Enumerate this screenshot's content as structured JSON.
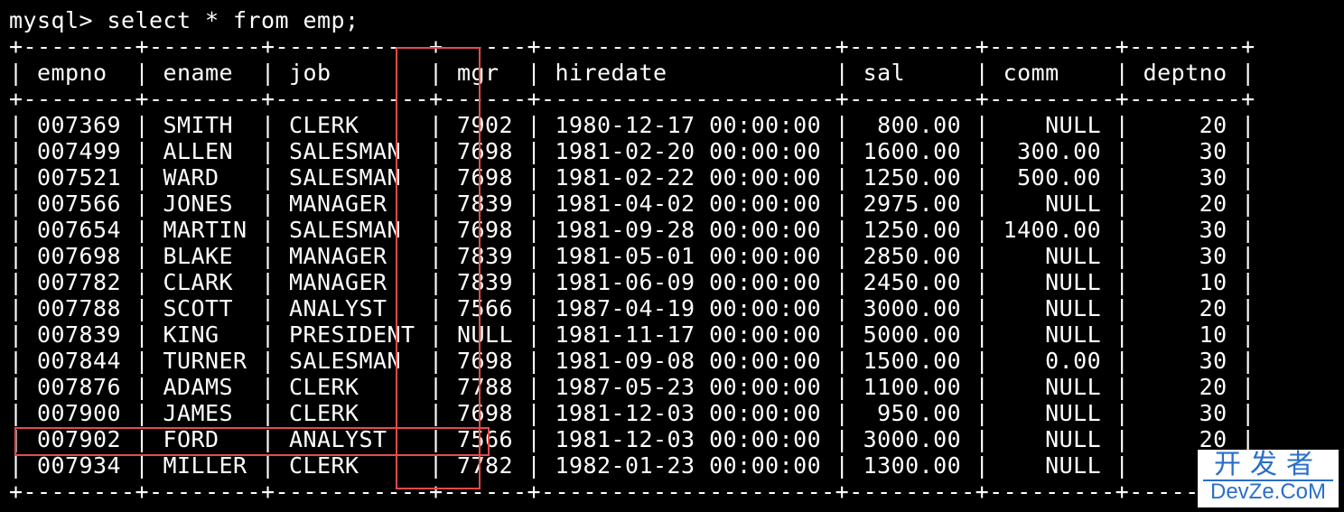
{
  "terminal": {
    "prompt": "mysql> select * from emp;",
    "border_line": "+--------+--------+-----------+------+---------------------+---------+---------+--------+",
    "header_line": "| empno  | ename  | job       | mgr  | hiredate            | sal     | comm    | deptno |",
    "rows": [
      "| 007369 | SMITH  | CLERK     | 7902 | 1980-12-17 00:00:00 |  800.00 |    NULL |     20 |",
      "| 007499 | ALLEN  | SALESMAN  | 7698 | 1981-02-20 00:00:00 | 1600.00 |  300.00 |     30 |",
      "| 007521 | WARD   | SALESMAN  | 7698 | 1981-02-22 00:00:00 | 1250.00 |  500.00 |     30 |",
      "| 007566 | JONES  | MANAGER   | 7839 | 1981-04-02 00:00:00 | 2975.00 |    NULL |     20 |",
      "| 007654 | MARTIN | SALESMAN  | 7698 | 1981-09-28 00:00:00 | 1250.00 | 1400.00 |     30 |",
      "| 007698 | BLAKE  | MANAGER   | 7839 | 1981-05-01 00:00:00 | 2850.00 |    NULL |     30 |",
      "| 007782 | CLARK  | MANAGER   | 7839 | 1981-06-09 00:00:00 | 2450.00 |    NULL |     10 |",
      "| 007788 | SCOTT  | ANALYST   | 7566 | 1987-04-19 00:00:00 | 3000.00 |    NULL |     20 |",
      "| 007839 | KING   | PRESIDENT | NULL | 1981-11-17 00:00:00 | 5000.00 |    NULL |     10 |",
      "| 007844 | TURNER | SALESMAN  | 7698 | 1981-09-08 00:00:00 | 1500.00 |    0.00 |     30 |",
      "| 007876 | ADAMS  | CLERK     | 7788 | 1987-05-23 00:00:00 | 1100.00 |    NULL |     20 |",
      "| 007900 | JAMES  | CLERK     | 7698 | 1981-12-03 00:00:00 |  950.00 |    NULL |     30 |",
      "| 007902 | FORD   | ANALYST   | 7566 | 1981-12-03 00:00:00 | 3000.00 |    NULL |     20 |",
      "| 007934 | MILLER | CLERK     | 7782 | 1982-01-23 00:00:00 | 1300.00 |    NULL |     10 |"
    ]
  },
  "watermark": {
    "top_text": "开发者",
    "bottom_text": "DevZe.CoM"
  },
  "colors": {
    "background": "#000000",
    "text": "#ffffff",
    "highlight": "#e84a4a",
    "watermark": "#2a6fc9"
  }
}
